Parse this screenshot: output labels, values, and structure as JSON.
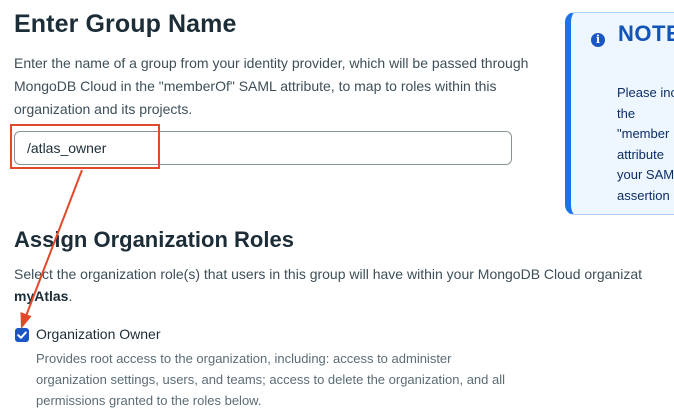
{
  "group_name": {
    "heading": "Enter Group Name",
    "description": "Enter the name of a group from your identity provider, which will be passed through MongoDB Cloud in the \"memberOf\" SAML attribute, to map to roles within this organization and its projects.",
    "input_value": "/atlas_owner"
  },
  "note": {
    "icon": "info-icon",
    "title": "NOTE",
    "lines": [
      "Please inc",
      "the",
      "\"member",
      "attribute",
      "your SAM",
      "assertion"
    ]
  },
  "roles": {
    "heading": "Assign Organization Roles",
    "description_line1": "Select the organization role(s) that users in this group will have within your MongoDB Cloud organizat",
    "org_name": "myAtlas",
    "org_suffix": ".",
    "option": {
      "label": "Organization Owner",
      "checked": true,
      "description_lines": [
        "Provides root access to the organization, including: access to administer",
        "organization settings, users, and teams; access to delete the organization, and all",
        "permissions granted to the roles below."
      ]
    }
  },
  "annotation": {
    "color": "#e2492a"
  }
}
